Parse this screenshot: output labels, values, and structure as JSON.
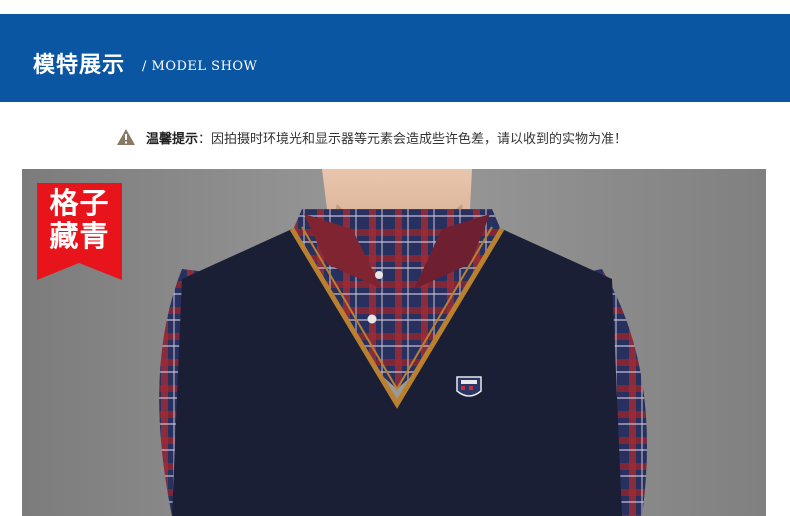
{
  "header": {
    "title": "模特展示",
    "subtitle": "/ MODEL SHOW",
    "background_color": "#0b56a3"
  },
  "notice": {
    "icon": "warning-triangle-icon",
    "label": "温馨提示",
    "text": "：因拍摄时环境光和显示器等元素会造成些许色差，请以收到的实物为准！"
  },
  "badge": {
    "line1": "格子",
    "line2": "藏青",
    "color": "#e8141b"
  },
  "photo": {
    "subject": "model-photo",
    "colors": {
      "vest": "#1b1f35",
      "trim": "#b9802f",
      "background": "#8c8c8c"
    }
  }
}
